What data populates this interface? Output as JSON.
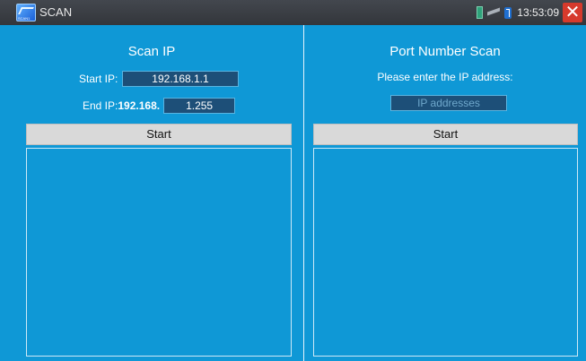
{
  "titlebar": {
    "app_icon_label": "SCAN1",
    "title": "SCAN",
    "clock": "13:53:09",
    "close_glyph": "✕",
    "icons": [
      "battery-icon",
      "network-icon",
      "bluetooth-icon",
      "close-icon"
    ]
  },
  "scan_ip": {
    "heading": "Scan IP",
    "start_label": "Start IP:",
    "start_value": "192.168.1.1",
    "end_label": "End IP:",
    "end_prefix": "192.168.",
    "end_value": "1.255",
    "start_button": "Start"
  },
  "port_scan": {
    "heading": "Port Number Scan",
    "prompt": "Please enter the IP address:",
    "ip_placeholder": "IP addresses",
    "start_button": "Start"
  },
  "colors": {
    "panel_bg": "#0f98d6",
    "titlebar_bg": "#3a3d42",
    "button_bg": "#d9d9d9",
    "close_red": "#d63a2c"
  }
}
